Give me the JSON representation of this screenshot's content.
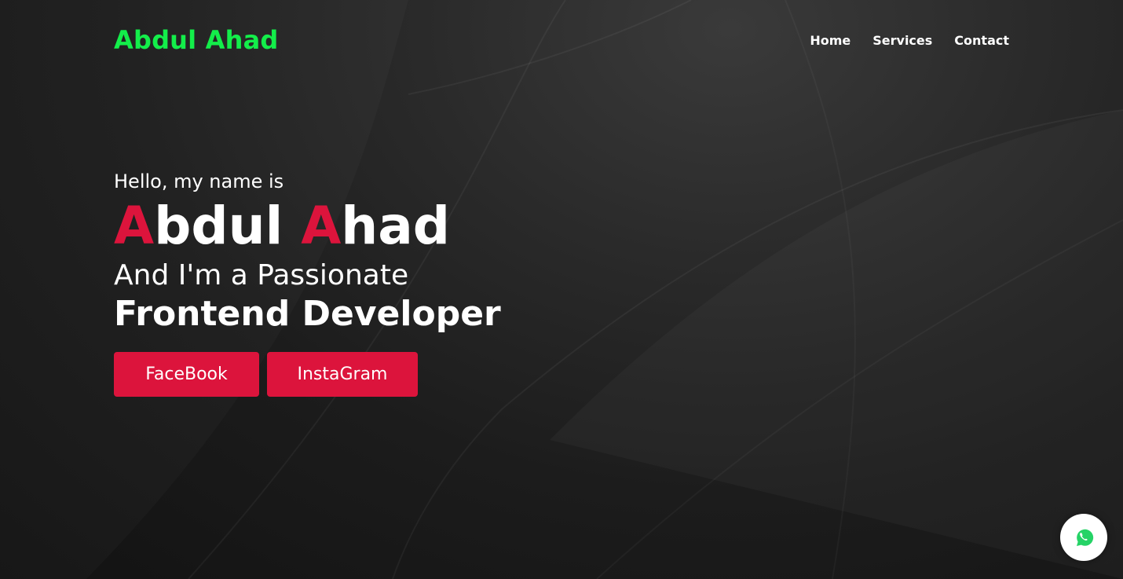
{
  "navbar": {
    "logo": "Abdul Ahad",
    "menu": [
      {
        "label": "Home"
      },
      {
        "label": "Services"
      },
      {
        "label": "Contact"
      }
    ]
  },
  "hero": {
    "greeting": "Hello, my name is",
    "name": {
      "first_initial": "A",
      "first_rest": "bdul",
      "last_initial": "A",
      "last_rest": "had"
    },
    "tagline": "And I'm a Passionate",
    "role": "Frontend Developer",
    "buttons": [
      {
        "label": "FaceBook"
      },
      {
        "label": "InstaGram"
      }
    ]
  },
  "floating": {
    "whatsapp_icon": "whatsapp-icon"
  },
  "colors": {
    "logo": "#13ee4a",
    "accent": "#dc143c",
    "background": "#1c1c1c",
    "text": "#ffffff"
  }
}
